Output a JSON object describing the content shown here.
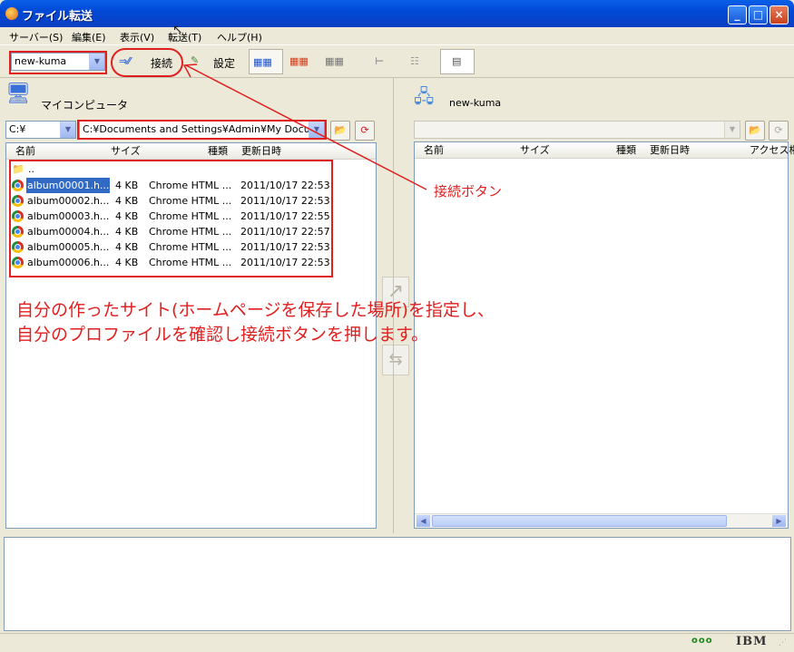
{
  "window": {
    "title": "ファイル転送",
    "min": "_",
    "max": "□",
    "close": "×"
  },
  "menu": [
    "サーバー(S)",
    "編集(E)",
    "表示(V)",
    "転送(T)",
    "ヘルプ(H)"
  ],
  "toolbar": {
    "profile": "new-kuma",
    "connect_label": "接続",
    "settings_label": "設定"
  },
  "left": {
    "title": "マイコンピュータ",
    "drive": "C:¥",
    "path": "C:¥Documents and Settings¥Admin¥My Documents",
    "columns": [
      "名前",
      "サイズ",
      "種類",
      "更新日時"
    ],
    "parent": "..",
    "files": [
      {
        "name": "album00001.h...",
        "size": "4 KB",
        "type": "Chrome HTML ...",
        "date": "2011/10/17 22:53"
      },
      {
        "name": "album00002.h...",
        "size": "4 KB",
        "type": "Chrome HTML ...",
        "date": "2011/10/17 22:53"
      },
      {
        "name": "album00003.h...",
        "size": "4 KB",
        "type": "Chrome HTML ...",
        "date": "2011/10/17 22:55"
      },
      {
        "name": "album00004.h...",
        "size": "4 KB",
        "type": "Chrome HTML ...",
        "date": "2011/10/17 22:57"
      },
      {
        "name": "album00005.h...",
        "size": "4 KB",
        "type": "Chrome HTML ...",
        "date": "2011/10/17 22:53"
      },
      {
        "name": "album00006.h...",
        "size": "4 KB",
        "type": "Chrome HTML ...",
        "date": "2011/10/17 22:53"
      }
    ]
  },
  "right": {
    "title": "new-kuma",
    "columns": [
      "名前",
      "サイズ",
      "種類",
      "更新日時",
      "アクセス権"
    ]
  },
  "annotations": {
    "connect_callout": "接続ボタン",
    "instruction_line1": "自分の作ったサイト(ホームページを保存した場所)を指定し、",
    "instruction_line2": "自分のプロファイルを確認し接続ボタンを押します。"
  },
  "status": {
    "dots": "ooo",
    "brand": "IBM"
  },
  "colors": {
    "annotation_red": "#e02020",
    "title_blue": "#0a5fe8",
    "selection": "#316ac5"
  }
}
